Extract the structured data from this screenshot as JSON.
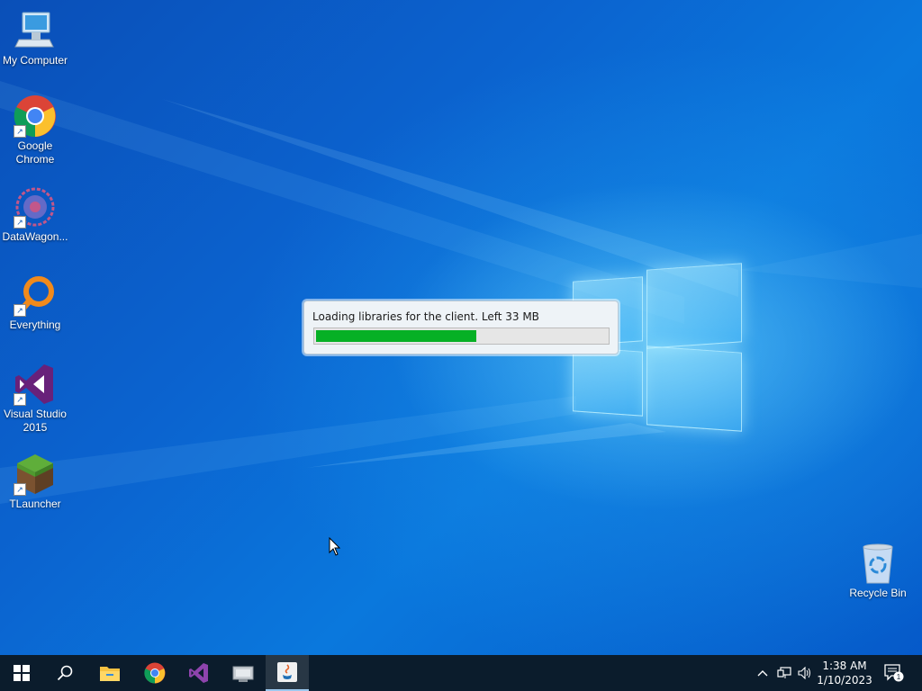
{
  "desktop": {
    "icons": [
      {
        "label": "My Computer"
      },
      {
        "label": "Google Chrome"
      },
      {
        "label": "DataWagon..."
      },
      {
        "label": "Everything"
      },
      {
        "label": "Visual Studio 2015"
      },
      {
        "label": "TLauncher"
      },
      {
        "label": "Recycle Bin"
      }
    ]
  },
  "dialog": {
    "message": "Loading libraries for the client. Left 33 MB",
    "progress": 0.55,
    "progress_color": "#06b025"
  },
  "taskbar": {
    "pinned": [
      "windows-start-icon",
      "search-icon",
      "file-explorer-icon",
      "chrome-icon",
      "visual-studio-icon",
      "hardware-icon",
      "java-icon"
    ],
    "active_app": "java-icon",
    "clock": {
      "time": "1:38 AM",
      "date": "1/10/2023"
    },
    "notification_count": "1"
  },
  "colors": {
    "taskbar_bg": "#0b1c2c",
    "desktop_blue": "#0b63cf"
  }
}
